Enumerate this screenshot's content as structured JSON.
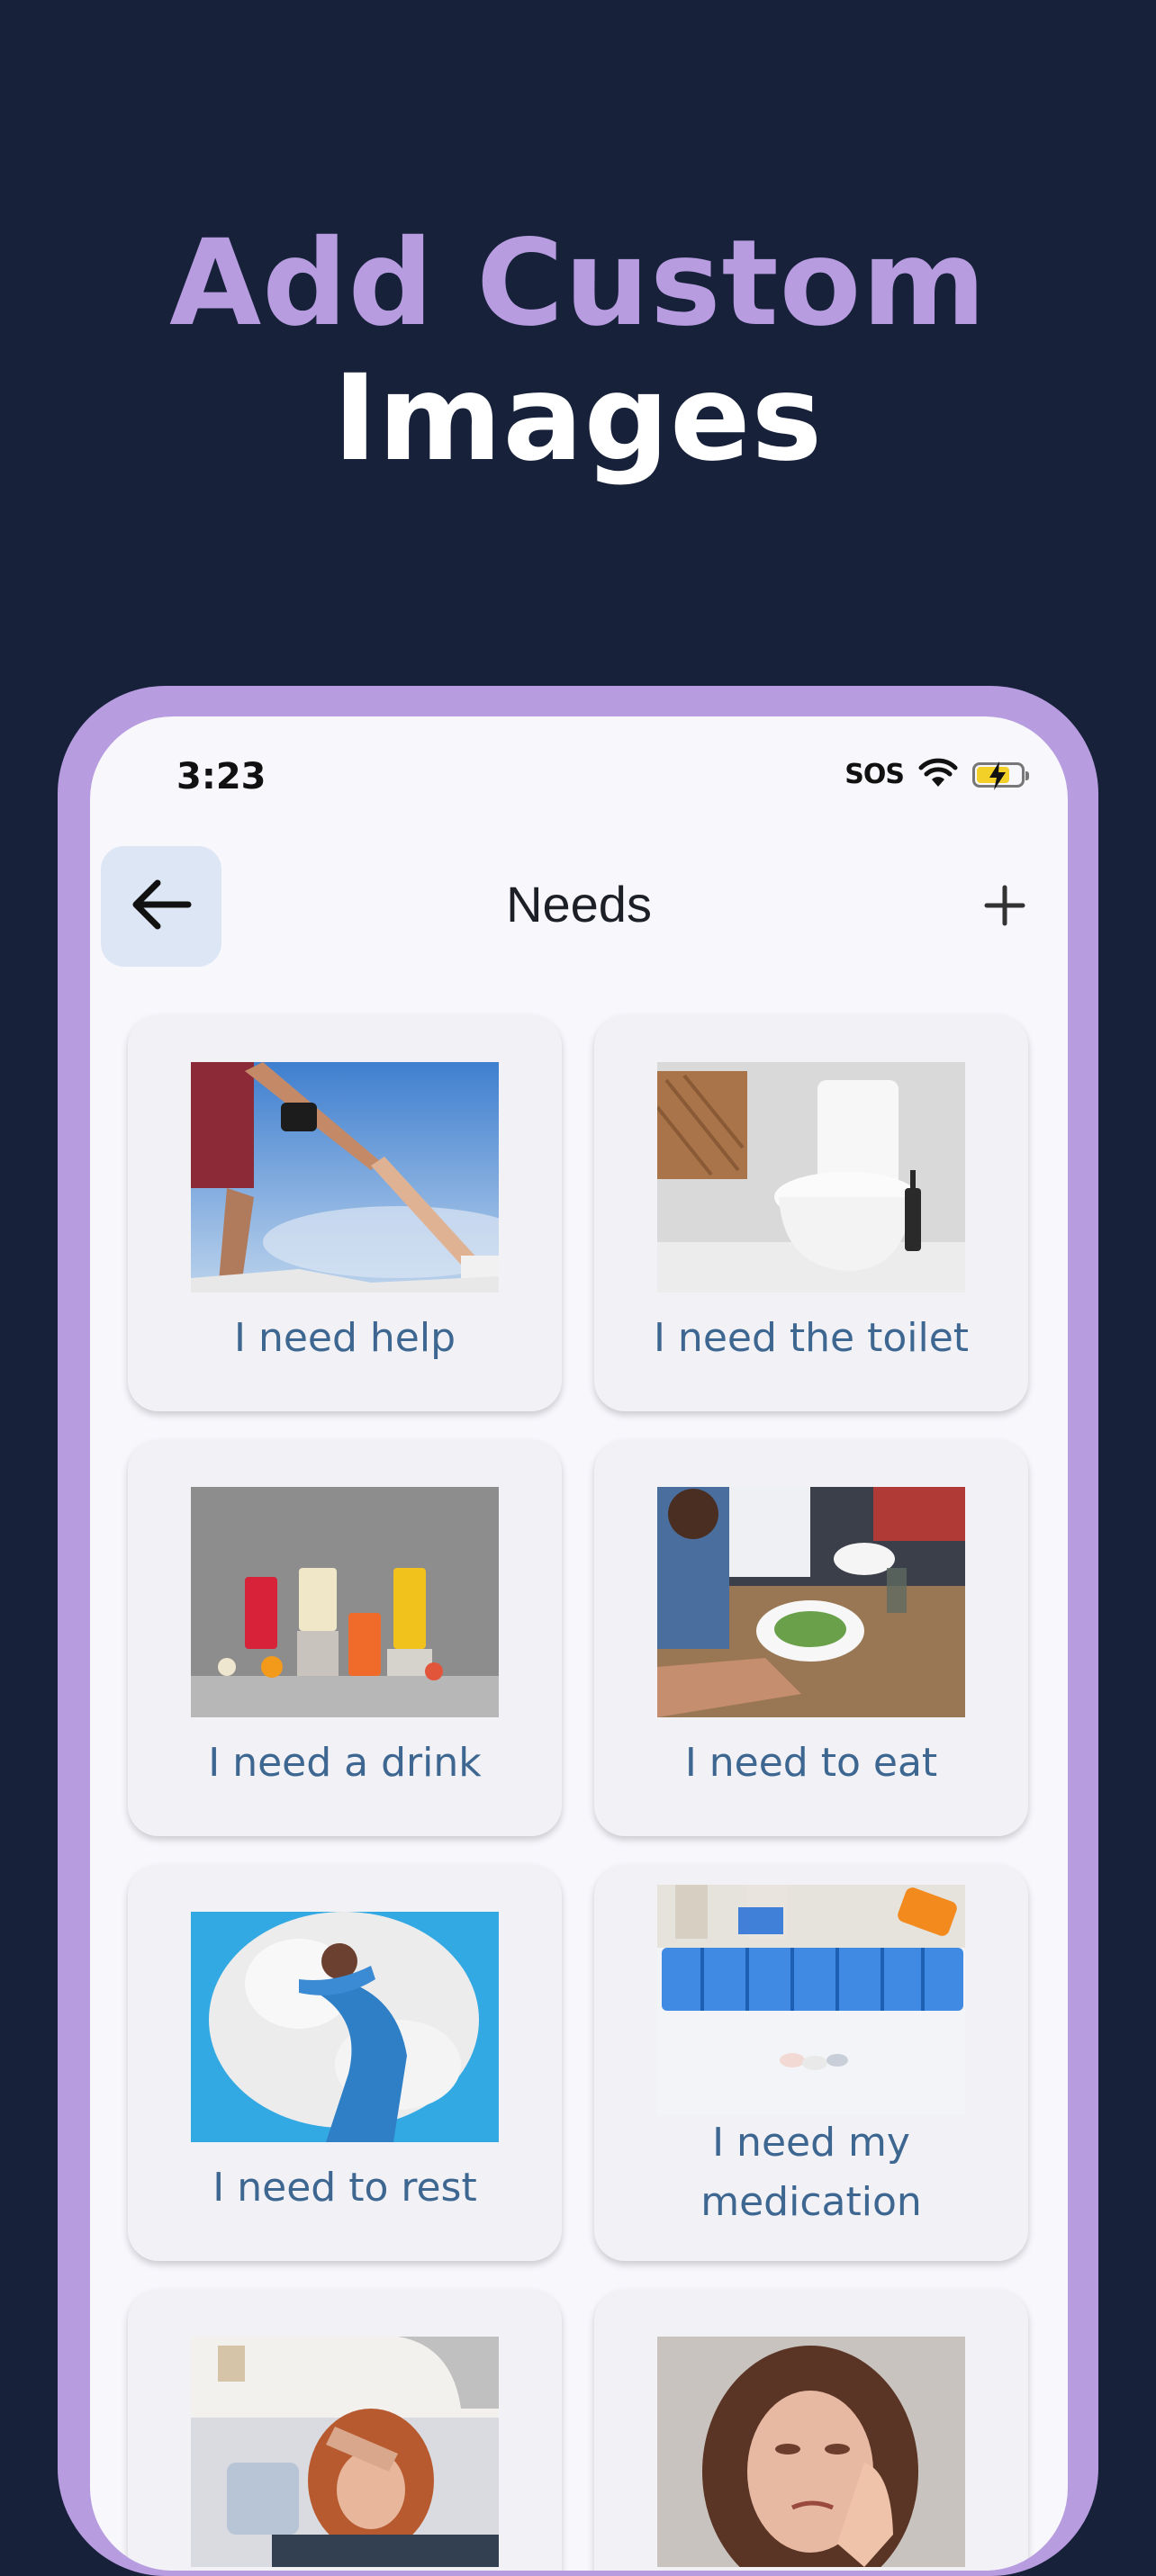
{
  "headline": {
    "line1": "Add Custom",
    "line2": "Images"
  },
  "status_bar": {
    "time": "3:23",
    "sos": "SOS"
  },
  "nav": {
    "title": "Needs"
  },
  "cards": [
    {
      "label": "I need help"
    },
    {
      "label": "I need the toilet"
    },
    {
      "label": "I need a drink"
    },
    {
      "label": "I need to eat"
    },
    {
      "label": "I need to rest"
    },
    {
      "label": "I need my medication"
    },
    {
      "label": ""
    },
    {
      "label": ""
    }
  ]
}
